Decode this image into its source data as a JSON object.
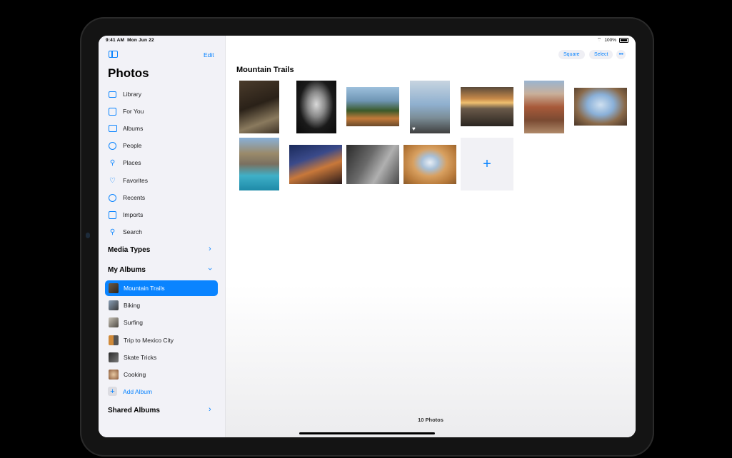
{
  "status_bar": {
    "time": "9:41 AM",
    "date": "Mon Jun 22",
    "battery": "100%"
  },
  "sidebar": {
    "edit_label": "Edit",
    "title": "Photos",
    "items": [
      {
        "label": "Library",
        "icon": "photo-library-icon"
      },
      {
        "label": "For You",
        "icon": "for-you-icon"
      },
      {
        "label": "Albums",
        "icon": "albums-icon"
      },
      {
        "label": "People",
        "icon": "people-icon"
      },
      {
        "label": "Places",
        "icon": "places-pin-icon"
      },
      {
        "label": "Favorites",
        "icon": "heart-icon"
      },
      {
        "label": "Recents",
        "icon": "clock-icon"
      },
      {
        "label": "Imports",
        "icon": "import-icon"
      },
      {
        "label": "Search",
        "icon": "search-icon"
      }
    ],
    "media_types_label": "Media Types",
    "my_albums_label": "My Albums",
    "albums": [
      {
        "label": "Mountain Trails",
        "selected": true
      },
      {
        "label": "Biking",
        "selected": false
      },
      {
        "label": "Surfing",
        "selected": false
      },
      {
        "label": "Trip to Mexico City",
        "selected": false
      },
      {
        "label": "Skate Tricks",
        "selected": false
      },
      {
        "label": "Cooking",
        "selected": false
      }
    ],
    "add_album_label": "Add Album",
    "shared_albums_label": "Shared Albums"
  },
  "toolbar": {
    "square_label": "Square",
    "select_label": "Select",
    "more_label": "•••"
  },
  "album": {
    "title": "Mountain Trails",
    "photo_count": "10 Photos",
    "add_label": "+"
  },
  "colors": {
    "accent": "#0a84ff",
    "sidebar_bg": "#f2f2f7",
    "selection": "#0a84ff"
  }
}
